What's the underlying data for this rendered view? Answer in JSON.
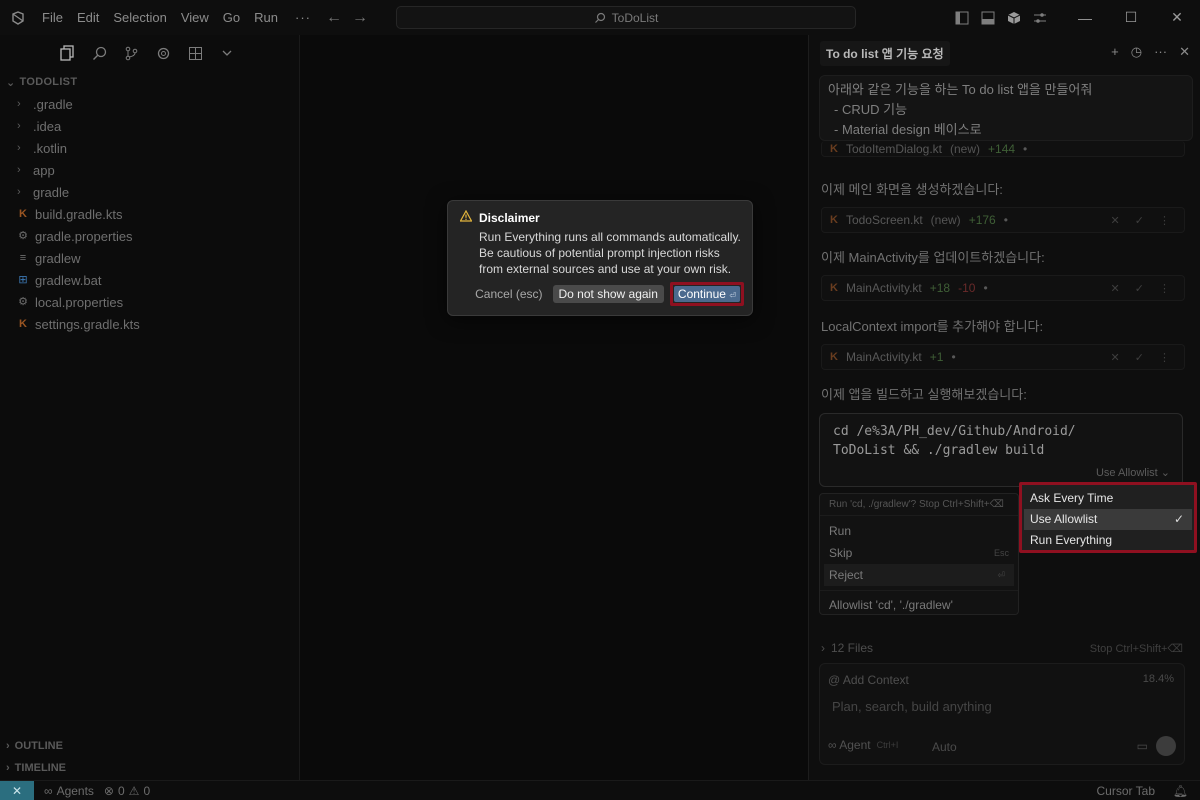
{
  "window": {
    "search_text": "ToDoList",
    "menu": [
      "File",
      "Edit",
      "Selection",
      "View",
      "Go",
      "Run"
    ],
    "more": "···"
  },
  "explorer": {
    "title": "TODOLIST",
    "items": [
      {
        "label": ".gradle",
        "type": "folder"
      },
      {
        "label": ".idea",
        "type": "folder"
      },
      {
        "label": ".kotlin",
        "type": "folder"
      },
      {
        "label": "app",
        "type": "folder"
      },
      {
        "label": "gradle",
        "type": "folder"
      },
      {
        "label": "build.gradle.kts",
        "type": "kotlin"
      },
      {
        "label": "gradle.properties",
        "type": "gear"
      },
      {
        "label": "gradlew",
        "type": "file"
      },
      {
        "label": "gradlew.bat",
        "type": "windows"
      },
      {
        "label": "local.properties",
        "type": "gear"
      },
      {
        "label": "settings.gradle.kts",
        "type": "kotlin"
      }
    ],
    "outline": "OUTLINE",
    "timeline": "TIMELINE"
  },
  "chat": {
    "tab_title": "To do list 앱 기능 요청",
    "user_message": {
      "line1": "아래와 같은 기능을 하는 To do list 앱을 만들어줘",
      "line2": "- CRUD 기능",
      "line3": "- Material design 베이스로"
    },
    "chip0": {
      "file": "TodoItemDialog.kt",
      "tag": "(new)",
      "plus": "+144",
      "dot": "•"
    },
    "line1": "이제 메인 화면을 생성하겠습니다:",
    "chip1": {
      "file": "TodoScreen.kt",
      "tag": "(new)",
      "plus": "+176",
      "dot": "•"
    },
    "line2": "이제 MainActivity를 업데이트하겠습니다:",
    "chip2": {
      "file": "MainActivity.kt",
      "plus": "+18",
      "minus": "-10",
      "dot": "•"
    },
    "line3": "LocalContext import를 추가해야 합니다:",
    "chip3": {
      "file": "MainActivity.kt",
      "plus": "+1",
      "dot": "•"
    },
    "line4": "이제 앱을 빌드하고 실행해보겠습니다:",
    "terminal": {
      "command": "cd /e%3A/PH_dev/Github/Android/\nToDoList && ./gradlew build",
      "policy": "Use Allowlist ⌄"
    },
    "run_menu": {
      "hint": "Run 'cd, ./gradlew'? Stop Ctrl+Shift+⌫",
      "run": "Run",
      "skip": "Skip",
      "skip_kbd": "Esc",
      "reject": "Reject",
      "reject_kbd": "⏎",
      "allowlist": "Allowlist 'cd', './gradlew'"
    },
    "files": {
      "label": "12 Files",
      "stop": "Stop Ctrl+Shift+⌫"
    },
    "input": {
      "add_context": "@ Add Context",
      "percent": "18.4%",
      "placeholder": "Plan, search, build anything",
      "agent": "∞ Agent",
      "agent_kbd": "Ctrl+I",
      "auto": "Auto"
    }
  },
  "mode_dropdown": {
    "items": [
      {
        "label": "Ask Every Time",
        "selected": false
      },
      {
        "label": "Use Allowlist",
        "selected": true
      },
      {
        "label": "Run Everything",
        "selected": false
      }
    ],
    "check": "✓",
    "highlight_color": "#8f1020"
  },
  "dialog": {
    "title": "Disclaimer",
    "body1": "Run Everything runs all commands automatically.",
    "body2": "Be cautious of potential prompt injection risks",
    "body3": "from external sources and use at your own risk.",
    "cancel": "Cancel (esc)",
    "dont_show": "Do not show again",
    "continue": "Continue",
    "continue_kbd": "⏎",
    "highlight_color": "#8f1020"
  },
  "statusbar": {
    "remote": "✕",
    "agents": "Agents",
    "errors": "0",
    "warnings": "0",
    "cursor_tab": "Cursor Tab"
  }
}
